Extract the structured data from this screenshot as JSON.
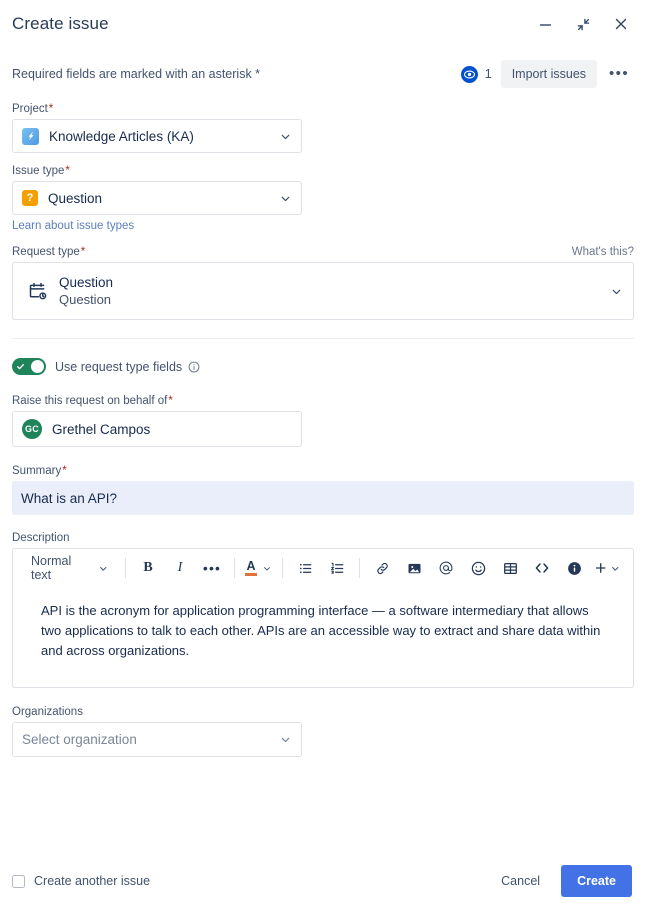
{
  "window": {
    "title": "Create issue",
    "minimize_label": "minimize",
    "collapse_label": "collapse",
    "close_label": "close"
  },
  "notice": {
    "text": "Required fields are marked with an asterisk *",
    "watch_count": "1",
    "import_label": "Import issues",
    "more_label": "•••"
  },
  "fields": {
    "project": {
      "label": "Project",
      "required": "*",
      "value": "Knowledge Articles (KA)"
    },
    "issue_type": {
      "label": "Issue type",
      "required": "*",
      "value": "Question",
      "icon_glyph": "?",
      "help_link": "Learn about issue types"
    },
    "request_type": {
      "label": "Request type",
      "required": "*",
      "whats_this": "What's this?",
      "title": "Question",
      "subtitle": "Question"
    },
    "use_request_type_fields": {
      "label": "Use request type fields",
      "state": "on"
    },
    "raise_on_behalf": {
      "label": "Raise this request on behalf of",
      "required": "*",
      "value": "Grethel Campos",
      "avatar_initials": "GC"
    },
    "summary": {
      "label": "Summary",
      "required": "*",
      "value": "What is an API?"
    },
    "description": {
      "label": "Description",
      "body": "API is the acronym for application programming interface — a software intermediary that allows two applications to talk to each other. APIs are an accessible way to extract and share data within and across organizations."
    },
    "organizations": {
      "label": "Organizations",
      "placeholder": "Select organization"
    }
  },
  "toolbar": {
    "text_style": "Normal text",
    "bold": "B",
    "italic": "I",
    "more": "•••",
    "text_color": "A",
    "bullet_list": "bullet-list",
    "numbered_list": "numbered-list",
    "link": "link",
    "image": "image",
    "mention": "@",
    "emoji": "emoji",
    "table": "table",
    "code": "<>",
    "info": "info",
    "insert": "+"
  },
  "footer": {
    "create_another_label": "Create another issue",
    "cancel_label": "Cancel",
    "create_label": "Create"
  },
  "colors": {
    "primary": "#4272e5",
    "link": "#5c7ebd",
    "required_asterisk": "#ae2a19",
    "toggle_on": "#1f845a",
    "watch_badge": "#0052cc",
    "summary_fill": "#e9eefa",
    "issue_type_icon": "#f59f00"
  }
}
